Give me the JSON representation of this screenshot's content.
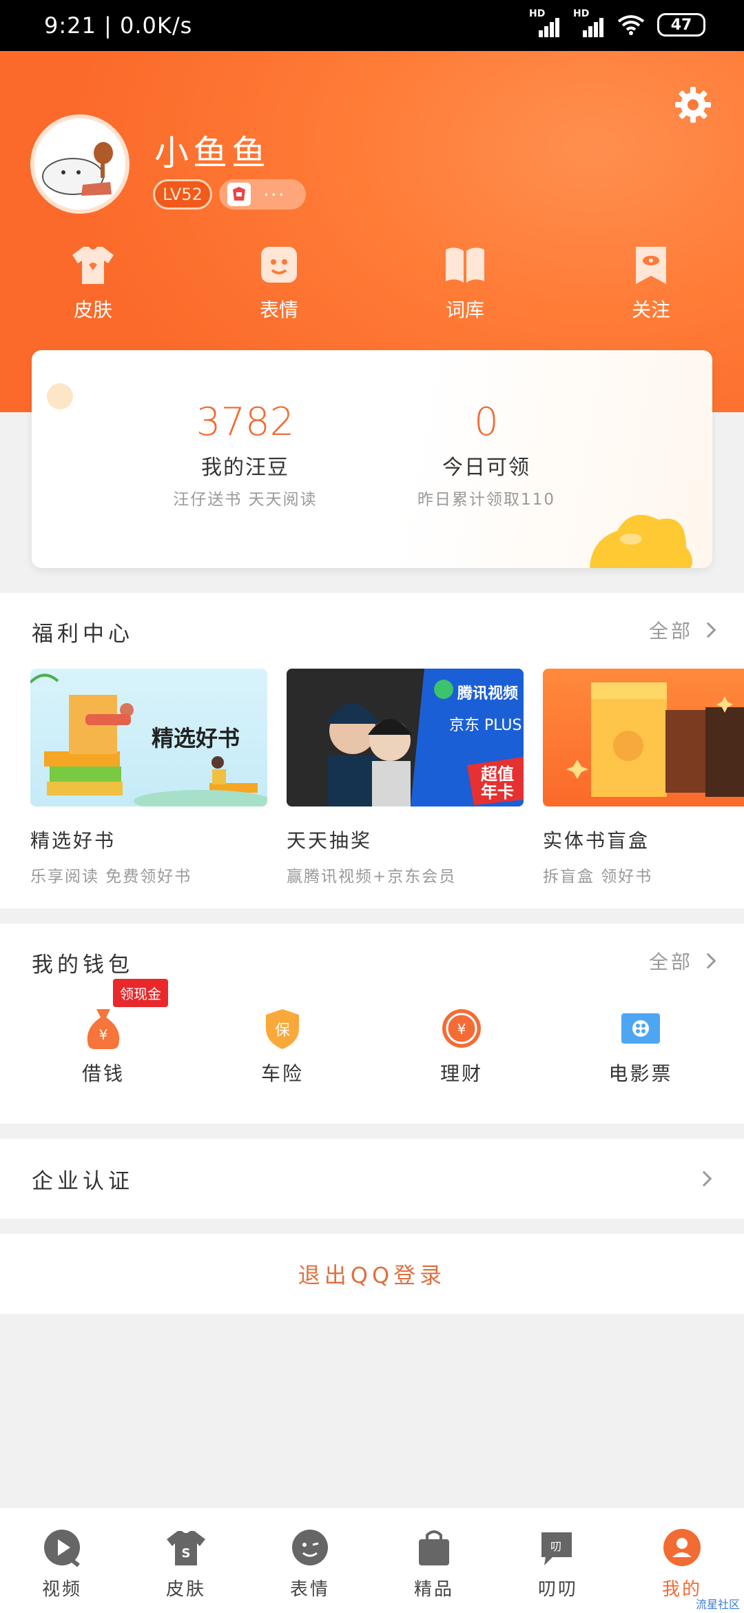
{
  "status_bar": {
    "time": "9:21 | 0.0K/s",
    "hd1": "HD",
    "hd2": "HD",
    "battery": "47"
  },
  "profile": {
    "username": "小鱼鱼",
    "level": "LV52",
    "more": "···"
  },
  "quick_actions": [
    {
      "label": "皮肤",
      "icon": "shirt-icon"
    },
    {
      "label": "表情",
      "icon": "emoji-icon"
    },
    {
      "label": "词库",
      "icon": "book-icon"
    },
    {
      "label": "关注",
      "icon": "eye-bookmark-icon"
    }
  ],
  "points": {
    "left": {
      "value": "3782",
      "title": "我的汪豆",
      "subtitle": "汪仔送书 天天阅读"
    },
    "right": {
      "value": "0",
      "title": "今日可领",
      "subtitle": "昨日累计领取110"
    }
  },
  "welfare": {
    "title": "福利中心",
    "all": "全部",
    "items": [
      {
        "title": "精选好书",
        "subtitle": "乐享阅读 免费领好书",
        "banner_text": "精选好书"
      },
      {
        "title": "天天抽奖",
        "subtitle": "赢腾讯视频+京东会员",
        "banner_line1": "腾讯视频",
        "banner_line2": "京东 PLUS",
        "banner_tag": "超值年卡"
      },
      {
        "title": "实体书盲盒",
        "subtitle": "拆盲盒 领好书"
      }
    ]
  },
  "wallet": {
    "title": "我的钱包",
    "all": "全部",
    "tag": "领现金",
    "items": [
      {
        "label": "借钱",
        "icon": "money-bag-icon",
        "glyph": "¥"
      },
      {
        "label": "车险",
        "icon": "shield-icon",
        "glyph": "保"
      },
      {
        "label": "理财",
        "icon": "coin-icon",
        "glyph": "¥"
      },
      {
        "label": "电影票",
        "icon": "ticket-icon"
      }
    ]
  },
  "enterprise": {
    "label": "企业认证"
  },
  "logout": {
    "label": "退出QQ登录"
  },
  "tabs": [
    {
      "label": "视频",
      "icon": "play-icon",
      "active": false
    },
    {
      "label": "皮肤",
      "icon": "shirt-icon",
      "active": false
    },
    {
      "label": "表情",
      "icon": "wink-icon",
      "active": false
    },
    {
      "label": "精品",
      "icon": "bag-icon",
      "active": false
    },
    {
      "label": "叨叨",
      "icon": "chat-icon",
      "active": false,
      "glyph": "叨"
    },
    {
      "label": "我的",
      "icon": "person-icon",
      "active": true
    }
  ],
  "watermark": "流星社区",
  "colors": {
    "brand_orange": "#fb6a2a",
    "accent_text": "#f26b32",
    "tag_red": "#e8282b"
  }
}
